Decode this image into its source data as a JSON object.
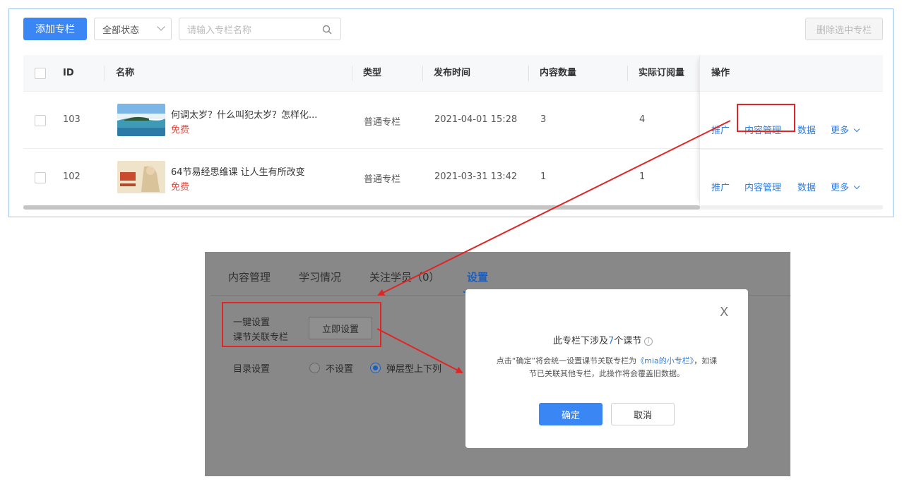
{
  "toolbar": {
    "add_label": "添加专栏",
    "status_select": "全部状态",
    "search_placeholder": "请输入专栏名称",
    "delete_label": "删除选中专栏"
  },
  "table": {
    "headers": {
      "id": "ID",
      "name": "名称",
      "type": "类型",
      "publish_time": "发布时间",
      "content_count": "内容数量",
      "subscribers": "实际订阅量",
      "actions": "操作"
    },
    "rows": [
      {
        "id": "103",
        "title": "何调太岁？什么叫犯太岁？怎样化...",
        "price": "免费",
        "type": "普通专栏",
        "publish_time": "2021-04-01 15:28",
        "content_count": "3",
        "subscribers": "4"
      },
      {
        "id": "102",
        "title": "64节易经思维课 让人生有所改变",
        "price": "免费",
        "type": "普通专栏",
        "publish_time": "2021-03-31 13:42",
        "content_count": "1",
        "subscribers": "1"
      }
    ],
    "actions": {
      "promote": "推广",
      "content": "内容管理",
      "data": "数据",
      "more": "更多"
    }
  },
  "settings_screen": {
    "tabs": [
      "内容管理",
      "学习情况",
      "关注学员（0）",
      "设置"
    ],
    "active_tab": "设置",
    "one_key_label_line1": "一键设置",
    "one_key_label_line2": "课节关联专栏",
    "one_key_button": "立即设置",
    "catalog_label": "目录设置",
    "catalog_options": [
      "不设置",
      "弹层型上下列"
    ],
    "catalog_selected": "弹层型上下列"
  },
  "dialog": {
    "close": "X",
    "title_before": "此专栏下涉及",
    "title_count": "7",
    "title_after": "个课节",
    "info_icon": "i",
    "text_line1_before": "点击“确定”将会统一设置课节关联专栏为",
    "text_line1_highlight": "《mia的小专栏》",
    "text_line1_after": "，如课",
    "text_line2": "节已关联其他专栏，此操作将会覆盖旧数据。",
    "ok": "确定",
    "cancel": "取消"
  },
  "colors": {
    "primary": "#3a86f5",
    "link": "#2f7de1",
    "free": "#e04a3f",
    "annotation": "#e02525"
  }
}
